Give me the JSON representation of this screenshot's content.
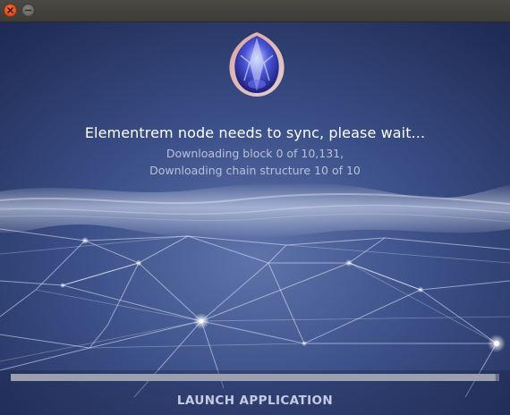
{
  "window": {
    "controls": [
      "close-icon",
      "minimize-icon"
    ]
  },
  "status": {
    "headline": "Elementrem node needs to sync, please wait...",
    "line1": "Downloading block 0 of 10,131,",
    "line2": "Downloading chain structure 10 of 10"
  },
  "progress": {
    "fraction": 0.99
  },
  "actions": {
    "launch_label": "LAUNCH APPLICATION"
  },
  "colors": {
    "background": "#2f3f6c",
    "text_primary": "#ffffff",
    "text_secondary": "#b9c1d8",
    "close_button": "#df4a16",
    "progress": "#9aa0b0"
  }
}
